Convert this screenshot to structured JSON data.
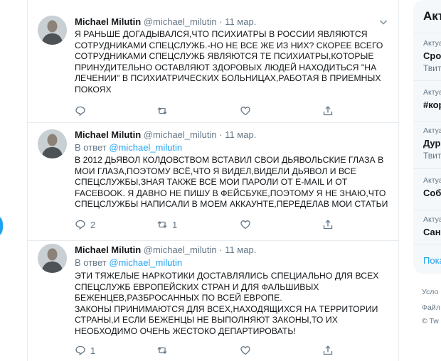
{
  "tweets": [
    {
      "author": "Michael Milutin",
      "handle": "@michael_milutin",
      "dot": "·",
      "date": "11 мар.",
      "reply_prefix": "",
      "reply_handle": "",
      "lines": [
        "Я РАНЬШЕ ДОГАДЫВАЛСЯ,ЧТО ПСИХИАТРЫ В РОССИИ ЯВЛЯЮТСЯ",
        "СОТРУДНИКАМИ СПЕЦСЛУЖБ.-НО НЕ ВСЕ ЖЕ ИЗ НИХ? СКОРЕЕ ВСЕГО",
        "СОТРУДНИКАМИ СПЕЦСЛУЖБ ЯВЛЯЮТСЯ ТЕ ПСИХИАТРЫ,КОТОРЫЕ",
        "ПРИНУДИТЕЛЬНО ОСТАВЛЯЮТ ЗДОРОВЫХ ЛЮДЕЙ НАХОДИТЬСЯ \"НА",
        "ЛЕЧЕНИИ\" В ПСИХИАТРИЧЕСКИХ БОЛЬНИЦАХ,РАБОТАЯ В ПРИЕМНЫХ",
        "ПОКОЯХ"
      ],
      "replies": "",
      "retweets": "",
      "likes": ""
    },
    {
      "author": "Michael Milutin",
      "handle": "@michael_milutin",
      "dot": "·",
      "date": "11 мар.",
      "reply_prefix": "В ответ",
      "reply_handle": "@michael_milutin",
      "lines": [
        "В 2012 ДЬЯВОЛ КОЛДОВСТВОМ ВСТАВИЛ СВОИ ДЬЯВОЛЬСКИЕ ГЛАЗА В",
        "МОИ ГЛАЗА,ПОЭТОМУ ВСЁ,ЧТО Я ВИДЕЛ,ВИДЕЛИ ДЬЯВОЛ И ВСЕ",
        "СПЕЦСЛУЖБЫ,ЗНАЯ ТАКЖЕ ВСЕ МОИ ПАРОЛИ ОТ E-MAIL И ОТ",
        "FACEBOOK. Я ДАВНО НЕ ПИШУ В ФЕЙСБУКЕ,ПОЭТОМУ Я НЕ ЗНАЮ,ЧТО",
        "СПЕЦСЛУЖБЫ НАПИСАЛИ В МОЕМ АККАУНТЕ,ПЕРЕДЕЛАВ МОИ СТАТЬИ"
      ],
      "replies": "2",
      "retweets": "1",
      "likes": ""
    },
    {
      "author": "Michael Milutin",
      "handle": "@michael_milutin",
      "dot": "·",
      "date": "11 мар.",
      "reply_prefix": "В ответ",
      "reply_handle": "@michael_milutin",
      "lines": [
        "ЭТИ ТЯЖЕЛЫЕ НАРКОТИКИ ДОСТАВЛЯЛИСЬ СПЕЦИАЛЬНО ДЛЯ ВСЕХ",
        "СПЕЦСЛУЖБ ЕВРОПЕЙСКИХ СТРАН И ДЛЯ ФАЛЬШИВЫХ",
        "БЕЖЕНЦЕВ,РАЗБРОСАННЫХ ПО ВСЕЙ ЕВРОПЕ.",
        "ЗАКОНЫ ПРИНИМАЮТСЯ ДЛЯ ВСЕХ,НАХОДЯЩИХСЯ НА ТЕРРИТОРИИ",
        "СТРАНЫ,И ЕСЛИ БЕЖЕНЦЫ НЕ ВЫПОЛНЯЮТ ЗАКОНЫ,ТО ИХ",
        "НЕОБХОДИМО ОЧЕНЬ ЖЕСТОКО ДЕПАРТИРОВАТЬ!"
      ],
      "replies": "1",
      "retweets": "",
      "likes": ""
    }
  ],
  "sidebar": {
    "title": "Акт",
    "trends": [
      {
        "category": "Актуа",
        "title": "Срoч",
        "subtitle": "Твит"
      },
      {
        "category": "Актуа",
        "title": "#кор",
        "subtitle": ""
      },
      {
        "category": "Актуа",
        "title": "Дурі",
        "subtitle": "Твит"
      },
      {
        "category": "Актуа",
        "title": "Собо",
        "subtitle": ""
      },
      {
        "category": "Актуа",
        "title": "Санк",
        "subtitle": ""
      }
    ],
    "show_more": "Пока",
    "footer": [
      "Усло",
      "Файл",
      "© Tw"
    ]
  },
  "icons": {
    "reply": "reply-icon",
    "retweet": "retweet-icon",
    "like": "heart-icon",
    "share": "share-icon",
    "caret": "chevron-down-icon"
  },
  "colors": {
    "accent": "#1da1f2",
    "secondary_text": "#657786",
    "border": "#e6ecf0"
  }
}
